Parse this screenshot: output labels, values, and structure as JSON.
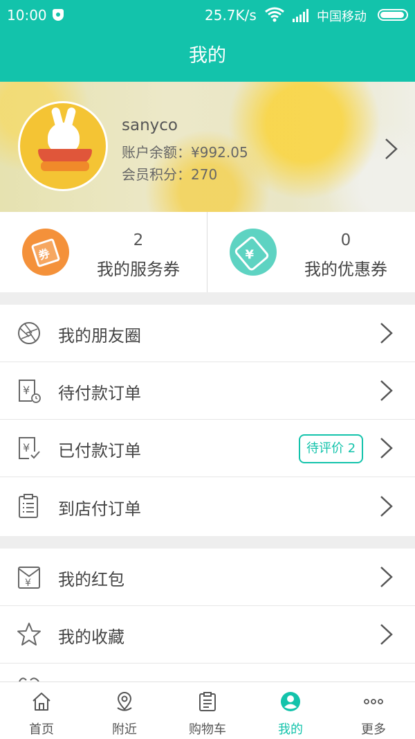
{
  "status_bar": {
    "time": "10:00",
    "net_speed": "25.7K/s",
    "carrier": "中国移动"
  },
  "header": {
    "title": "我的"
  },
  "profile": {
    "username": "sanyco",
    "balance": "账户余额：¥992.05",
    "points": "会员积分：270"
  },
  "coupons": [
    {
      "count": "2",
      "label": "我的服务券",
      "icon": "ticket-icon",
      "color": "#f4913a"
    },
    {
      "count": "0",
      "label": "我的优惠券",
      "icon": "price-tag-icon",
      "color": "#5ed3c2"
    }
  ],
  "menu_group_1": [
    {
      "label": "我的朋友圈",
      "icon": "aperture-icon"
    },
    {
      "label": "待付款订单",
      "icon": "yuan-clock-icon"
    },
    {
      "label": "已付款订单",
      "icon": "yuan-check-icon",
      "badge": "待评价 2"
    },
    {
      "label": "到店付订单",
      "icon": "clipboard-list-icon"
    }
  ],
  "menu_group_2": [
    {
      "label": "我的红包",
      "icon": "red-envelope-icon"
    },
    {
      "label": "我的收藏",
      "icon": "star-icon"
    }
  ],
  "tabbar": [
    {
      "label": "首页",
      "icon": "home-icon"
    },
    {
      "label": "附近",
      "icon": "location-pin-icon"
    },
    {
      "label": "购物车",
      "icon": "clipboard-icon"
    },
    {
      "label": "我的",
      "icon": "user-icon",
      "active": true
    },
    {
      "label": "更多",
      "icon": "more-dots-icon"
    }
  ],
  "colors": {
    "accent": "#13c3ab"
  }
}
